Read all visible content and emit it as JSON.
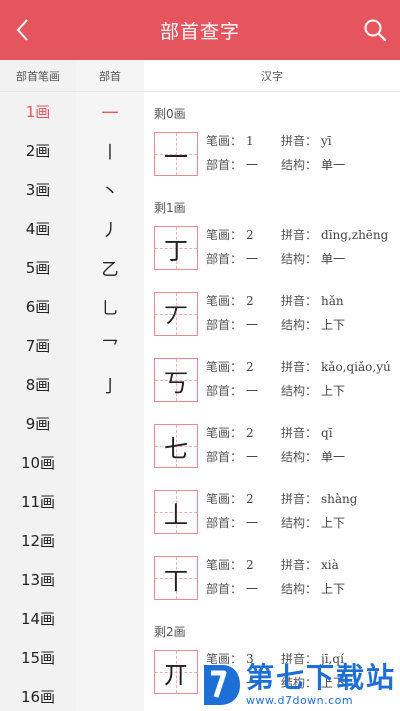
{
  "header": {
    "title": "部首查字",
    "back_icon": "chevron-left-icon",
    "search_icon": "search-icon",
    "background": "#e5555e"
  },
  "columns": {
    "stroke_header": "部首笔画",
    "radical_header": "部首",
    "chars_header": "汉字"
  },
  "stroke_counts": [
    "1画",
    "2画",
    "3画",
    "4画",
    "5画",
    "6画",
    "7画",
    "8画",
    "9画",
    "10画",
    "11画",
    "12画",
    "13画",
    "14画",
    "15画",
    "16画"
  ],
  "stroke_selected": "1画",
  "radicals": [
    "一",
    "丨",
    "丶",
    "丿",
    "乙",
    "乚",
    "乛",
    "亅"
  ],
  "radical_selected": "一",
  "labels": {
    "strokes": "笔画：",
    "pinyin": "拼音：",
    "radical": "部首：",
    "structure": "结构："
  },
  "groups": [
    {
      "title": "剩0画",
      "chars": [
        {
          "char": "一",
          "strokes": "1",
          "pinyin": "yī",
          "radical": "一",
          "structure": "单一"
        }
      ]
    },
    {
      "title": "剩1画",
      "chars": [
        {
          "char": "丁",
          "strokes": "2",
          "pinyin": "dīng,zhēng",
          "radical": "一",
          "structure": "单一"
        },
        {
          "char": "丆",
          "strokes": "2",
          "pinyin": "hǎn",
          "radical": "一",
          "structure": "上下"
        },
        {
          "char": "丂",
          "strokes": "2",
          "pinyin": "kǎo,qiǎo,yú",
          "radical": "一",
          "structure": "上下"
        },
        {
          "char": "七",
          "strokes": "2",
          "pinyin": "qī",
          "radical": "一",
          "structure": "单一"
        },
        {
          "char": "丄",
          "strokes": "2",
          "pinyin": "shàng",
          "radical": "一",
          "structure": "上下"
        },
        {
          "char": "丅",
          "strokes": "2",
          "pinyin": "xià",
          "radical": "一",
          "structure": "上下"
        }
      ]
    },
    {
      "title": "剩2画",
      "chars": [
        {
          "char": "丌",
          "strokes": "3",
          "pinyin": "jī,qí",
          "radical": "一",
          "structure": "上下"
        }
      ]
    }
  ],
  "watermark": {
    "brand": "第七下载站",
    "url": "www.d7down.com",
    "color": "#1d6fd6"
  }
}
